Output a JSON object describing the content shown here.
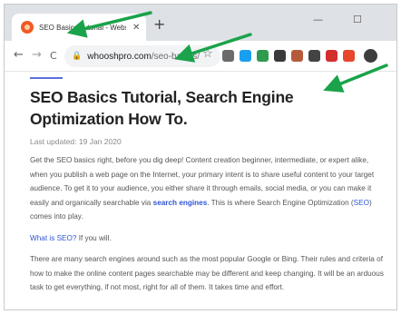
{
  "browser": {
    "tab": {
      "title": "SEO Basics Tutorial - Website Se",
      "close_glyph": "✕"
    },
    "new_tab_glyph": "+",
    "window_controls": {
      "minimize": "—",
      "maximize": "☐"
    },
    "nav": {
      "back": "←",
      "forward": "→",
      "reload": "C"
    },
    "address": {
      "lock_glyph": "🔒",
      "domain": "whooshpro.com",
      "path": "/seo-basics/"
    },
    "bookmark_glyph": "☆",
    "extensions": [
      {
        "name": "camera-icon",
        "color": "#6b6b6b"
      },
      {
        "name": "skype-icon",
        "color": "#1a9ef0"
      },
      {
        "name": "tag-icon",
        "color": "#2e9b4f"
      },
      {
        "name": "bug-icon",
        "color": "#3a3a3a"
      },
      {
        "name": "image-icon",
        "color": "#b65b3a"
      },
      {
        "name": "wordpress-icon",
        "color": "#444444"
      },
      {
        "name": "video-icon",
        "color": "#d32f2f"
      },
      {
        "name": "scribd-icon",
        "color": "#e8472c"
      }
    ]
  },
  "article": {
    "title": "SEO Basics Tutorial, Search Engine Optimization How To.",
    "last_updated": "Last updated: 19 Jan 2020",
    "paragraph1": {
      "text_before": "Get the SEO basics right, before you dig deep! Content creation beginner, intermediate, or expert alike, when you publish a web page on the Internet, your primary intent is to share useful content to your target audience. To get it to your audience, you either share it through emails, social media, or you can make it easily and organically searchable via ",
      "link1": "search engines",
      "text_mid": ". This is where Search Engine Optimization (",
      "link2": "SEO",
      "text_after": ") comes into play."
    },
    "paragraph2": {
      "link": "What is SEO?",
      "text_after": " If you will."
    },
    "paragraph3": "There are many search engines around such as the most popular Google or Bing. Their rules and criteria of how to make the online content pages searchable may be different and keep changing. It will be an arduous task to get everything, if not most, right for all of them. It takes time and effort."
  },
  "colors": {
    "accent": "#5b6fe0",
    "link": "#2f56d6",
    "annotation_arrow": "#1aa34a"
  }
}
